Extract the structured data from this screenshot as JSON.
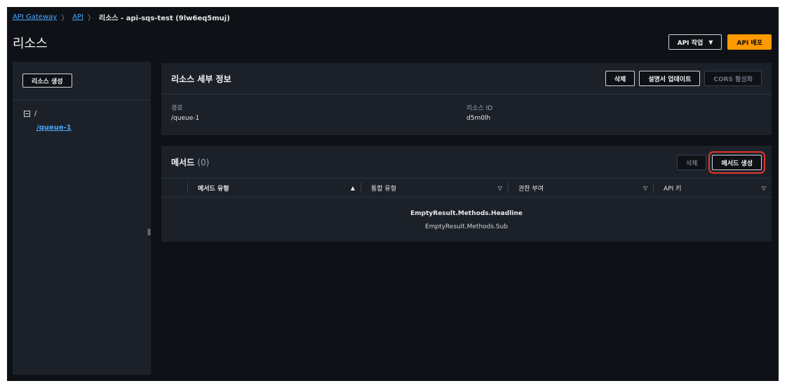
{
  "breadcrumb": {
    "items": [
      "API Gateway",
      "API"
    ],
    "current": "리소스 - api-sqs-test (9lw6eq5muj)"
  },
  "page": {
    "title": "리소스"
  },
  "top_actions": {
    "api_actions": "API 작업",
    "deploy": "API 배포"
  },
  "sidebar": {
    "create_resource": "리소스 생성",
    "tree": {
      "root": "/",
      "child": "/queue-1"
    }
  },
  "details": {
    "title": "리소스 세부 정보",
    "delete": "삭제",
    "update_docs": "설명서 업데이트",
    "enable_cors": "CORS 활성화",
    "path_label": "경로",
    "path_value": "/queue-1",
    "id_label": "리소스 ID",
    "id_value": "d5m0lh"
  },
  "methods": {
    "title": "메서드",
    "count": "(0)",
    "delete": "삭제",
    "create": "메서드 생성",
    "columns": [
      "메서드 유형",
      "통합 유형",
      "권한 부여",
      "API 키"
    ],
    "empty_headline": "EmptyResult.Methods.Headline",
    "empty_sub": "EmptyResult.Methods.Sub"
  },
  "colors": {
    "accent": "#ff9900",
    "link": "#4aa8ff",
    "highlight": "#e5362a",
    "background": "#0e1116",
    "panel": "#1c2129"
  }
}
